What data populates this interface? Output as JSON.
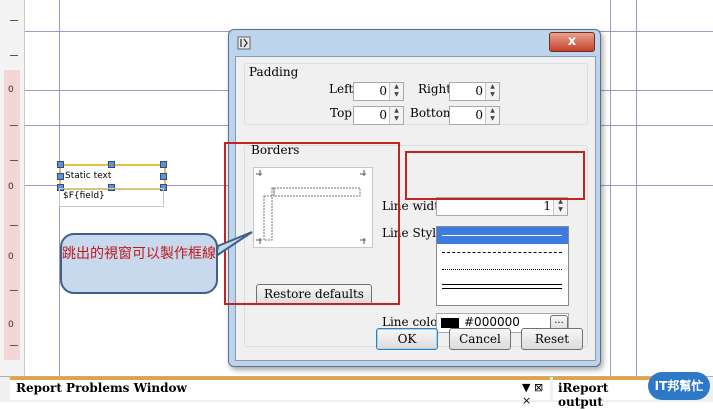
{
  "report": {
    "static_text": "Static text",
    "field_text": "$F{field}",
    "ruler_labels": [
      "0",
      "0",
      "0",
      "0"
    ]
  },
  "dialog": {
    "close_symbol": "x",
    "padding": {
      "title": "Padding",
      "left_label": "Left",
      "left_value": "0",
      "right_label": "Right",
      "right_value": "0",
      "top_label": "Top",
      "top_value": "0",
      "bottom_label": "Bottom",
      "bottom_value": "0"
    },
    "borders": {
      "title": "Borders",
      "restore_label": "Restore defaults",
      "line_width_label": "Line width",
      "line_width_value": "1",
      "line_style_label": "Line Style",
      "line_color_label": "Line color",
      "line_color_value": "#000000",
      "line_color_swatch": "#000000",
      "color_button_label": "..."
    },
    "buttons": {
      "ok": "OK",
      "cancel": "Cancel",
      "reset": "Reset"
    }
  },
  "annotation": {
    "callout_text": "跳出的視窗可以製作框線"
  },
  "bottom": {
    "panel_title": "Report Problems Window",
    "panel_controls": "▼ ⊠ ×",
    "output_tab": "iReport output",
    "watermark": "IT邦幫忙"
  }
}
